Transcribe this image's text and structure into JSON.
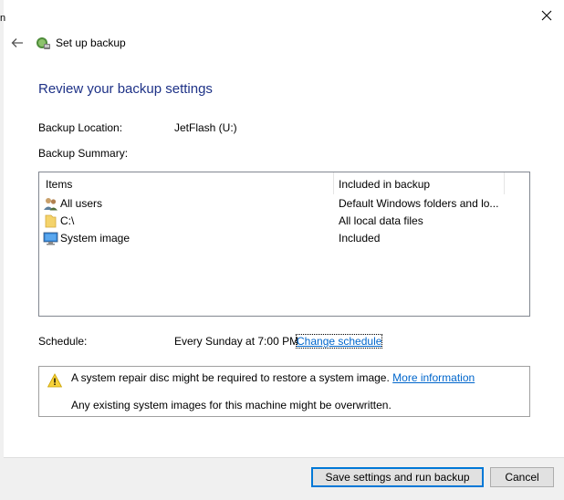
{
  "window": {
    "title": "Set up backup",
    "edge_glyph": "n"
  },
  "icons": {
    "close": "close-icon",
    "back": "back-arrow-icon",
    "app": "backup-icon",
    "users": "users-icon",
    "folder": "folder-icon",
    "computer": "computer-icon",
    "warning": "warning-icon"
  },
  "main": {
    "heading": "Review your backup settings",
    "backup_location_label": "Backup Location:",
    "backup_location_value": "JetFlash (U:)",
    "backup_summary_label": "Backup Summary:",
    "summary": {
      "columns": [
        "Items",
        "Included in backup"
      ],
      "rows": [
        {
          "name": "All users",
          "included": "Default Windows folders and lo...",
          "icon": "users-icon"
        },
        {
          "name": "C:\\",
          "included": "All local data files",
          "icon": "folder-icon"
        },
        {
          "name": "System image",
          "included": "Included",
          "icon": "computer-icon"
        }
      ]
    },
    "schedule_label": "Schedule:",
    "schedule_value": "Every Sunday at 7:00 PM",
    "change_schedule": "Change schedule",
    "warning": {
      "line1": "A system repair disc might be required to restore a system image.",
      "more_info": "More information",
      "line2": "Any existing system images for this machine might be overwritten."
    }
  },
  "footer": {
    "save_button": "Save settings and run backup",
    "cancel_button": "Cancel"
  },
  "colors": {
    "heading": "#1e3287",
    "link": "#0066cc",
    "footer_bg": "#f0f0f0",
    "primary_border": "#0078d7"
  }
}
